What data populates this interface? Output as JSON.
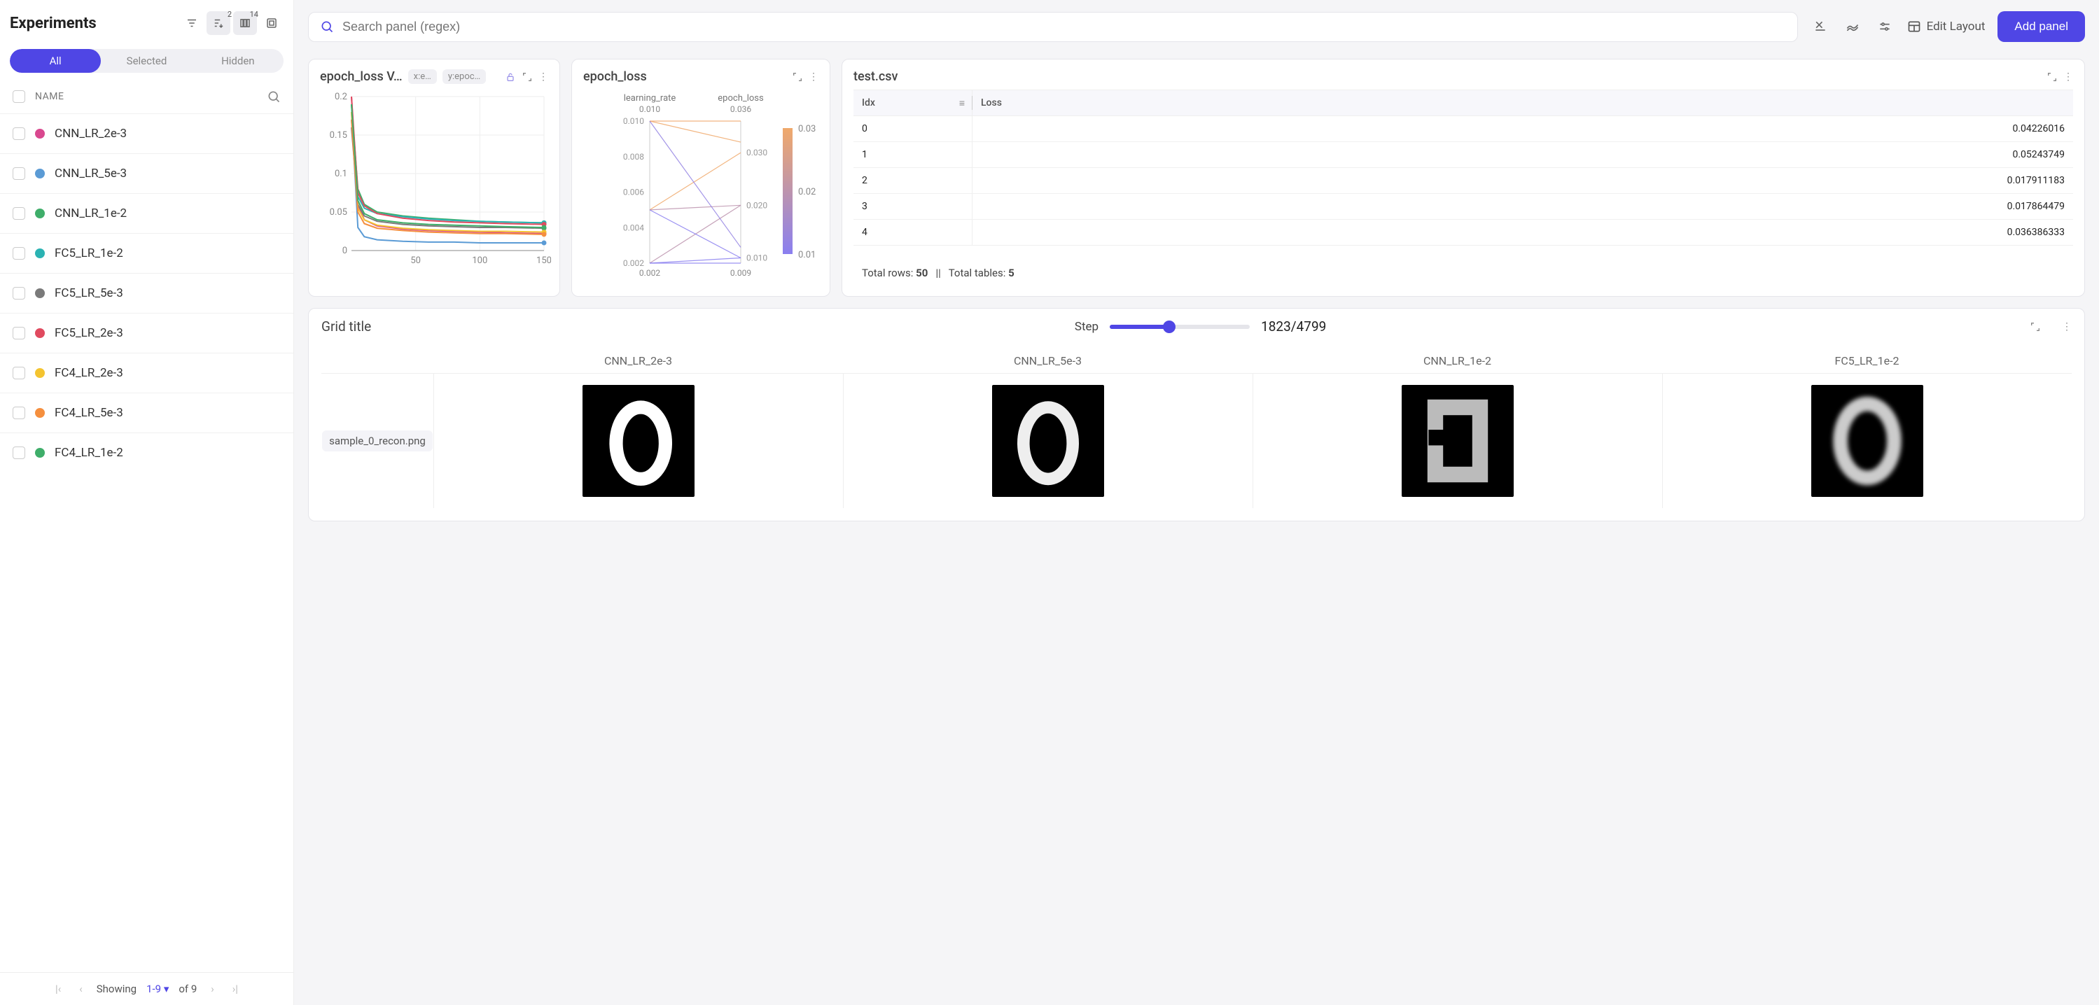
{
  "sidebar": {
    "title": "Experiments",
    "badge_sort": "2",
    "badge_cols": "14",
    "tabs": {
      "all": "All",
      "selected": "Selected",
      "hidden": "Hidden"
    },
    "name_header": "NAME",
    "experiments": [
      {
        "name": "CNN_LR_2e-3",
        "color": "#d9488f"
      },
      {
        "name": "CNN_LR_5e-3",
        "color": "#5b9bd5"
      },
      {
        "name": "CNN_LR_1e-2",
        "color": "#3fae6a"
      },
      {
        "name": "FC5_LR_1e-2",
        "color": "#2bb3b3"
      },
      {
        "name": "FC5_LR_5e-3",
        "color": "#7a7a7a"
      },
      {
        "name": "FC5_LR_2e-3",
        "color": "#e04a5f"
      },
      {
        "name": "FC4_LR_2e-3",
        "color": "#f4c430"
      },
      {
        "name": "FC4_LR_5e-3",
        "color": "#f58f3e"
      },
      {
        "name": "FC4_LR_1e-2",
        "color": "#3fae6a"
      }
    ],
    "pager": {
      "showing": "Showing",
      "range": "1-9",
      "of": "of 9"
    }
  },
  "topbar": {
    "search_placeholder": "Search panel (regex)",
    "edit_layout": "Edit Layout",
    "add_panel": "Add panel"
  },
  "panels": {
    "loss_chart": {
      "title": "epoch_loss V…",
      "tag_x": "x:e…",
      "tag_y": "y:epoc…"
    },
    "parallel": {
      "title": "epoch_loss",
      "left_label": "learning_rate",
      "right_label": "epoch_loss",
      "left_top": "0.010",
      "right_top": "0.036",
      "left_ticks": [
        "0.010",
        "0.008",
        "0.006",
        "0.004",
        "0.002"
      ],
      "right_ticks": [
        "0.030",
        "0.020",
        "0.010"
      ],
      "legend_ticks": [
        "0.03",
        "0.02",
        "0.01"
      ],
      "left_bottom": "0.002",
      "right_bottom": "0.009"
    },
    "table": {
      "title": "test.csv",
      "col_idx": "Idx",
      "col_loss": "Loss",
      "rows": [
        {
          "idx": "0",
          "loss": "0.04226016"
        },
        {
          "idx": "1",
          "loss": "0.05243749"
        },
        {
          "idx": "2",
          "loss": "0.017911183"
        },
        {
          "idx": "3",
          "loss": "0.017864479"
        },
        {
          "idx": "4",
          "loss": "0.036386333"
        }
      ],
      "footer_rows_label": "Total rows:",
      "footer_rows_val": "50",
      "footer_sep": "||",
      "footer_tables_label": "Total tables:",
      "footer_tables_val": "5"
    },
    "grid": {
      "title": "Grid title",
      "step_label": "Step",
      "step_count": "1823/4799",
      "columns": [
        "CNN_LR_2e-3",
        "CNN_LR_5e-3",
        "CNN_LR_1e-2",
        "FC5_LR_1e-2"
      ],
      "row_label": "sample_0_recon.png"
    }
  },
  "chart_data": [
    {
      "type": "line",
      "title": "epoch_loss V…",
      "xlabel": "",
      "ylabel": "",
      "xlim": [
        0,
        150
      ],
      "ylim": [
        0,
        0.2
      ],
      "xticks": [
        50,
        100,
        150
      ],
      "yticks": [
        0,
        0.05,
        0.1,
        0.15,
        0.2
      ],
      "x": [
        0,
        5,
        10,
        20,
        40,
        60,
        80,
        100,
        120,
        150
      ],
      "series": [
        {
          "name": "CNN_LR_2e-3",
          "color": "#d9488f",
          "values": [
            0.2,
            0.06,
            0.04,
            0.032,
            0.028,
            0.026,
            0.025,
            0.024,
            0.023,
            0.022
          ]
        },
        {
          "name": "CNN_LR_5e-3",
          "color": "#5b9bd5",
          "values": [
            0.18,
            0.03,
            0.018,
            0.014,
            0.012,
            0.011,
            0.011,
            0.01,
            0.01,
            0.01
          ]
        },
        {
          "name": "CNN_LR_1e-2",
          "color": "#3fae6a",
          "values": [
            0.19,
            0.08,
            0.06,
            0.05,
            0.045,
            0.042,
            0.04,
            0.038,
            0.037,
            0.036
          ]
        },
        {
          "name": "FC5_LR_1e-2",
          "color": "#2bb3b3",
          "values": [
            0.17,
            0.07,
            0.055,
            0.048,
            0.044,
            0.041,
            0.039,
            0.038,
            0.037,
            0.036
          ]
        },
        {
          "name": "FC5_LR_5e-3",
          "color": "#7a7a7a",
          "values": [
            0.16,
            0.06,
            0.045,
            0.038,
            0.034,
            0.032,
            0.031,
            0.03,
            0.03,
            0.029
          ]
        },
        {
          "name": "FC5_LR_2e-3",
          "color": "#e04a5f",
          "values": [
            0.2,
            0.075,
            0.058,
            0.048,
            0.042,
            0.039,
            0.037,
            0.036,
            0.035,
            0.034
          ]
        },
        {
          "name": "FC4_LR_2e-3",
          "color": "#f4c430",
          "values": [
            0.18,
            0.055,
            0.04,
            0.033,
            0.029,
            0.027,
            0.026,
            0.025,
            0.025,
            0.024
          ]
        },
        {
          "name": "FC4_LR_5e-3",
          "color": "#f58f3e",
          "values": [
            0.17,
            0.05,
            0.035,
            0.029,
            0.026,
            0.024,
            0.023,
            0.022,
            0.022,
            0.021
          ]
        },
        {
          "name": "FC4_LR_1e-2",
          "color": "#3fae6a",
          "values": [
            0.19,
            0.065,
            0.048,
            0.04,
            0.036,
            0.034,
            0.033,
            0.032,
            0.031,
            0.03
          ]
        }
      ]
    },
    {
      "type": "parallel",
      "title": "epoch_loss",
      "axes": [
        {
          "name": "learning_rate",
          "range": [
            0.002,
            0.01
          ]
        },
        {
          "name": "epoch_loss",
          "range": [
            0.009,
            0.036
          ]
        }
      ],
      "color_scale": {
        "by": "epoch_loss",
        "range": [
          0.01,
          0.03
        ],
        "low_color": "#8a7ff0",
        "high_color": "#f0a96b"
      },
      "lines": [
        {
          "learning_rate": 0.01,
          "epoch_loss": 0.036
        },
        {
          "learning_rate": 0.01,
          "epoch_loss": 0.032
        },
        {
          "learning_rate": 0.005,
          "epoch_loss": 0.03
        },
        {
          "learning_rate": 0.005,
          "epoch_loss": 0.02
        },
        {
          "learning_rate": 0.002,
          "epoch_loss": 0.02
        },
        {
          "learning_rate": 0.005,
          "epoch_loss": 0.01
        },
        {
          "learning_rate": 0.002,
          "epoch_loss": 0.01
        },
        {
          "learning_rate": 0.002,
          "epoch_loss": 0.009
        },
        {
          "learning_rate": 0.01,
          "epoch_loss": 0.012
        }
      ]
    },
    {
      "type": "table",
      "title": "test.csv",
      "columns": [
        "Idx",
        "Loss"
      ],
      "rows": [
        [
          0,
          0.04226016
        ],
        [
          1,
          0.05243749
        ],
        [
          2,
          0.017911183
        ],
        [
          3,
          0.017864479
        ],
        [
          4,
          0.036386333
        ]
      ],
      "total_rows": 50,
      "total_tables": 5
    }
  ]
}
